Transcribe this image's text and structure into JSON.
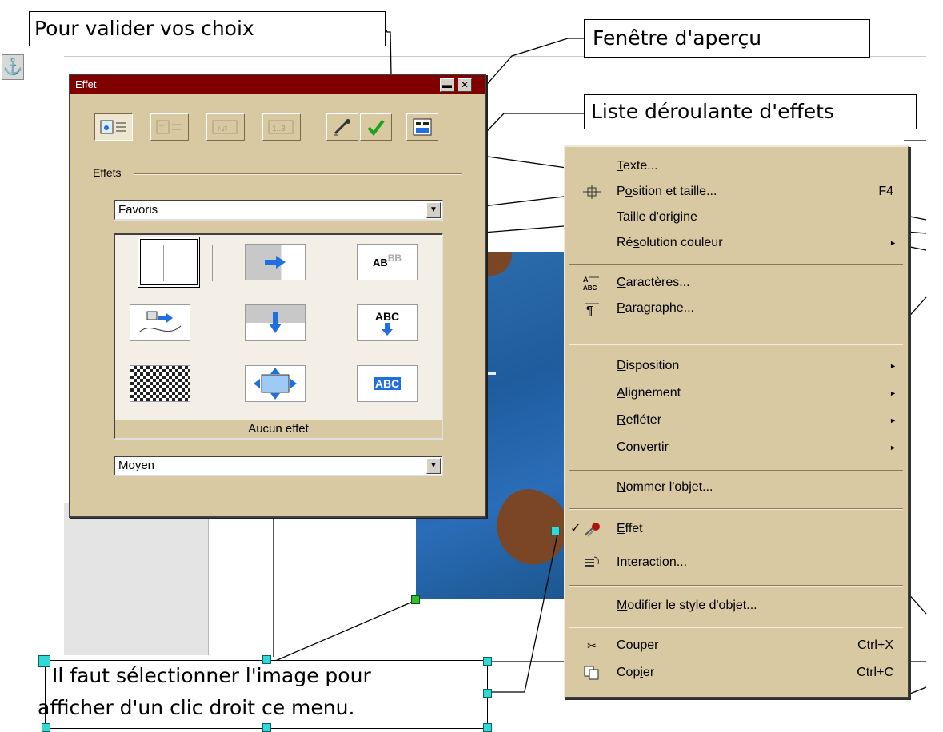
{
  "callouts": {
    "validate": "Pour valider vos choix",
    "preview": "Fenêtre d'aperçu",
    "effects_list": "Liste déroulante d'effets",
    "instruction_line1": "Il faut sélectionner l'image pour",
    "instruction_line2": "afficher d'un clic droit ce menu."
  },
  "dialog": {
    "title": "Effet",
    "minimize_glyph": "▬",
    "close_glyph": "✕",
    "group_label": "Effets",
    "category_value": "Favoris",
    "effect_none_label": "Aucun effet",
    "speed_value": "Moyen",
    "combo_arrow": "▼",
    "toolbar_icons": [
      "effects-tab-icon",
      "text-effects-tab-icon",
      "sound-effects-tab-icon",
      "order-effects-tab-icon",
      "pipette-icon",
      "apply-checkmark-icon",
      "preview-window-icon"
    ],
    "icon_text": {
      "ab": "AB",
      "abc": "ABC"
    }
  },
  "menu": {
    "items": [
      {
        "label": "Texte...",
        "mnemonic": "T",
        "shortcut": "",
        "submenu": false,
        "icon": ""
      },
      {
        "label": "Position et taille...",
        "mnemonic": "o",
        "shortcut": "F4",
        "submenu": false,
        "icon": "position-size-icon"
      },
      {
        "label": "Taille d'origine",
        "mnemonic": "",
        "shortcut": "",
        "submenu": false,
        "icon": ""
      },
      {
        "label": "Résolution couleur",
        "mnemonic": "s",
        "shortcut": "",
        "submenu": true,
        "icon": ""
      },
      {
        "label": "Caractères...",
        "mnemonic": "C",
        "shortcut": "",
        "submenu": false,
        "icon": "characters-icon"
      },
      {
        "label": "Paragraphe...",
        "mnemonic": "P",
        "shortcut": "",
        "submenu": false,
        "icon": "paragraph-icon"
      },
      {
        "label": "Disposition",
        "mnemonic": "D",
        "shortcut": "",
        "submenu": true,
        "icon": ""
      },
      {
        "label": "Alignement",
        "mnemonic": "A",
        "shortcut": "",
        "submenu": true,
        "icon": ""
      },
      {
        "label": "Refléter",
        "mnemonic": "R",
        "shortcut": "",
        "submenu": true,
        "icon": ""
      },
      {
        "label": "Convertir",
        "mnemonic": "C",
        "shortcut": "",
        "submenu": true,
        "icon": ""
      },
      {
        "label": "Nommer l'objet...",
        "mnemonic": "N",
        "shortcut": "",
        "submenu": false,
        "icon": ""
      },
      {
        "label": "Effet",
        "mnemonic": "E",
        "shortcut": "",
        "submenu": false,
        "icon": "effect-comet-icon",
        "checked": true
      },
      {
        "label": "Interaction...",
        "mnemonic": "",
        "shortcut": "",
        "submenu": false,
        "icon": "interaction-icon"
      },
      {
        "label": "Modifier le style d'objet...",
        "mnemonic": "M",
        "shortcut": "",
        "submenu": false,
        "icon": ""
      },
      {
        "label": "Couper",
        "mnemonic": "C",
        "shortcut": "Ctrl+X",
        "submenu": false,
        "icon": "scissors-icon"
      },
      {
        "label": "Copier",
        "mnemonic": "i",
        "shortcut": "Ctrl+C",
        "submenu": false,
        "icon": "copy-icon"
      }
    ],
    "submenu_glyph": "►",
    "check_glyph": "✓"
  },
  "colors": {
    "titlebar": "#800000",
    "dialog_bg": "#d9c9a3",
    "menu_bg": "#d9c9a3",
    "handle": "#30d8d8",
    "arrow_blue": "#1f6fe0"
  }
}
